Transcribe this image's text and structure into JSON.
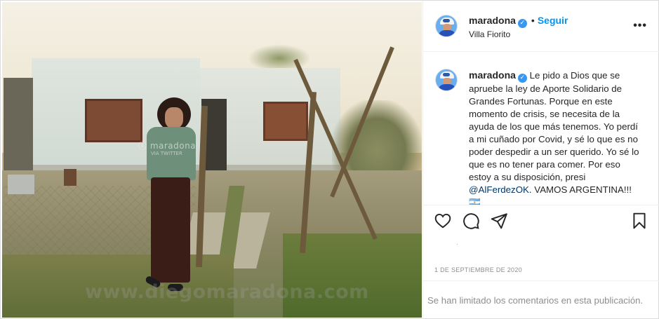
{
  "post": {
    "username": "maradona",
    "location": "Villa Fiorito",
    "follow_label": "Seguir",
    "dot": "•",
    "more_label": "•••",
    "verified_mark": "✓"
  },
  "photo": {
    "watermark_handle": "ⓘ maradona",
    "watermark_sub": "VIA TWITTER",
    "watermark_site": "www.diegomaradona.com"
  },
  "caption": {
    "username": "maradona",
    "text_before_mention": "Le pido a Dios que se apruebe la ley de Aporte Solidario de Grandes Fortunas. Porque en este momento de crisis, se necesita de la ayuda de los que más tenemos. Yo perdí a mi cuñado por Covid, y sé lo que es no poder despedir a un ser querido. Yo sé lo que es no tener para comer. Por eso estoy a su disposición, presi ",
    "mention": "@AlFerdezOK",
    "text_after_mention": ". VAMOS ARGENTINA!!! 🇦🇷"
  },
  "actions": {
    "like_icon": "heart-outline",
    "comment_icon": "speech-bubble-outline",
    "share_icon": "paper-plane-outline",
    "save_icon": "bookmark-outline"
  },
  "meta": {
    "tiny_mark": "·",
    "date": "1 de septiembre de 2020",
    "comments_limited": "Se han limitado los comentarios en esta publicación."
  },
  "colors": {
    "accent": "#0095f6",
    "verified": "#3897f0",
    "mention": "#00376b",
    "muted": "#8e8e8e",
    "border": "#efefef"
  }
}
